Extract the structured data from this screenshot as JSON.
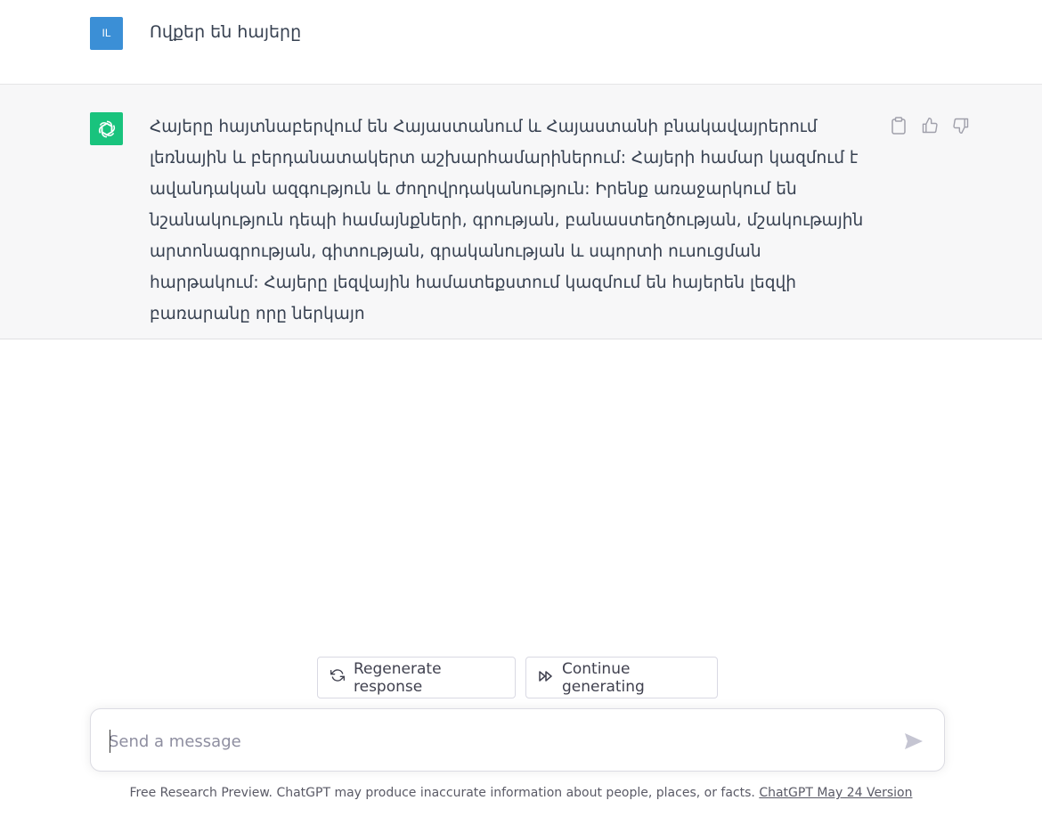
{
  "user_message": {
    "avatar_initials": "IL",
    "text": "Ովքեր են հայերը"
  },
  "assistant_message": {
    "avatar_icon": "openai-logo-icon",
    "text": "Հայերը հայտնաբերվում են Հայաստանում և Հայաստանի բնակավայրերում լեռնային և բերդանատակերտ աշխարհամարիներում: Հայերի համար կազմում է ավանդական ազգություն և ժողովրդականություն: Իրենք առաջարկում են նշանակություն դեպի համայնքների, գրության, բանաստեղծության, մշակութային արտոնագրության, գիտության, գրականության և սպորտի ուսուցման հարթակում: Հայերը լեզվային համատեքստում կազմում են հայերեն լեզվի բառարանը որը ներկայո",
    "actions": [
      "clipboard-icon",
      "thumbs-up-icon",
      "thumbs-down-icon"
    ]
  },
  "buttons": {
    "regenerate_label": "Regenerate response",
    "continue_label": "Continue generating"
  },
  "composer": {
    "placeholder": "Send a message",
    "value": ""
  },
  "footer": {
    "text": "Free Research Preview. ChatGPT may produce inaccurate information about people, places, or facts. ",
    "link_text": "ChatGPT May 24 Version"
  },
  "colors": {
    "user_avatar": "#3b8fd6",
    "assistant_avatar": "#19c37d",
    "assistant_bg": "#f7f7f8"
  }
}
